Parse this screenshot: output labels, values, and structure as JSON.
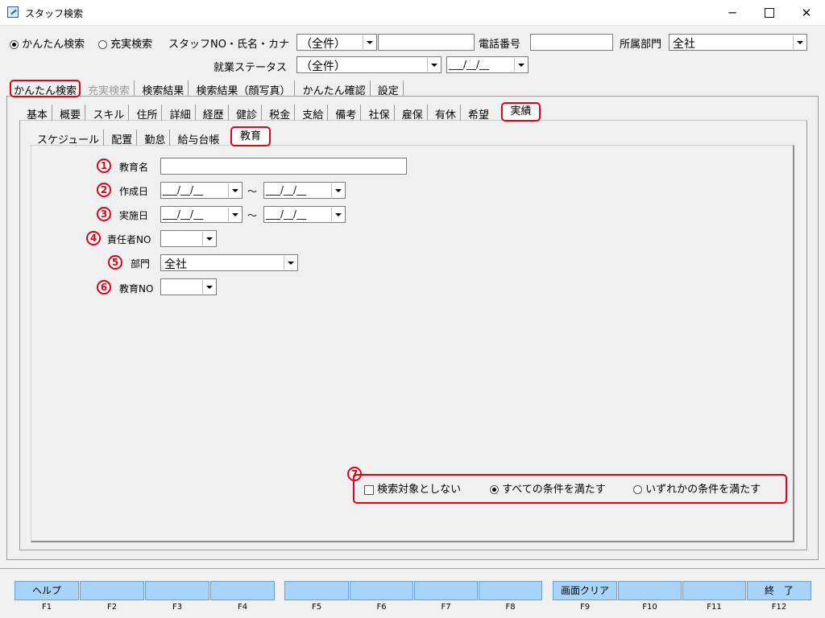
{
  "window": {
    "title": "スタッフ検索",
    "min_icon": "─",
    "close_icon": "✕"
  },
  "header": {
    "mode_simple": "かんたん検索",
    "mode_full": "充実検索",
    "staff_label": "スタッフNO・氏名・カナ",
    "staff_combo": "（全件）",
    "phone_label": "電話番号",
    "dept_label": "所属部門",
    "dept_value": "全社",
    "status_label": "就業ステータス",
    "status_value": "（全件）",
    "status_date": "___/__/__"
  },
  "main_tabs": [
    "かんたん検索",
    "充実検索",
    "検索結果",
    "検索結果（顔写真）",
    "かんたん確認",
    "設定"
  ],
  "sub_tabs": [
    "基本",
    "概要",
    "スキル",
    "住所",
    "詳細",
    "経歴",
    "健診",
    "税金",
    "支給",
    "備考",
    "社保",
    "雇保",
    "有休",
    "希望",
    "実績"
  ],
  "sub_sub_tabs": [
    "スケジュール",
    "配置",
    "勤怠",
    "給与台帳",
    "教育"
  ],
  "form": {
    "num1": "1",
    "num2": "2",
    "num3": "3",
    "num4": "4",
    "num5": "5",
    "num6": "6",
    "num7": "7",
    "education_name_label": "教育名",
    "created_label": "作成日",
    "implemented_label": "実施日",
    "responsible_label": "責任者NO",
    "dept_label": "部門",
    "dept_value": "全社",
    "education_no_label": "教育NO",
    "date_placeholder": "___/__/__",
    "range_sep": "～"
  },
  "conditions": {
    "exclude": "検索対象としない",
    "all": "すべての条件を満たす",
    "any": "いずれかの条件を満たす"
  },
  "fkeys": {
    "labels": [
      "ヘルプ",
      "",
      "",
      "",
      "",
      "",
      "",
      "",
      "画面クリア",
      "",
      "",
      "終　了"
    ],
    "names": [
      "F1",
      "F2",
      "F3",
      "F4",
      "F5",
      "F6",
      "F7",
      "F8",
      "F9",
      "F10",
      "F11",
      "F12"
    ]
  },
  "colors": {
    "accent_red": "#e60012",
    "fkey_blue": "#a8d4f9"
  }
}
